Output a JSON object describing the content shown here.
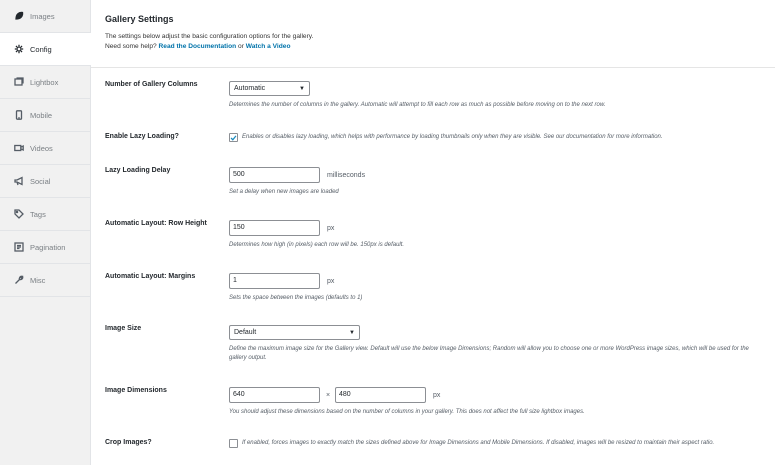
{
  "sidebar": {
    "tabs": [
      {
        "label": "Images",
        "icon": "leaf-icon",
        "active": false
      },
      {
        "label": "Config",
        "icon": "gear-icon",
        "active": true
      },
      {
        "label": "Lightbox",
        "icon": "lightbox-icon",
        "active": false
      },
      {
        "label": "Mobile",
        "icon": "mobile-icon",
        "active": false
      },
      {
        "label": "Videos",
        "icon": "video-icon",
        "active": false
      },
      {
        "label": "Social",
        "icon": "megaphone-icon",
        "active": false
      },
      {
        "label": "Tags",
        "icon": "tag-icon",
        "active": false
      },
      {
        "label": "Pagination",
        "icon": "pagination-icon",
        "active": false
      },
      {
        "label": "Misc",
        "icon": "wrench-icon",
        "active": false
      }
    ]
  },
  "header": {
    "title": "Gallery Settings",
    "desc_line1": "The settings below adjust the basic configuration options for the gallery.",
    "help_prefix": "Need some help?",
    "doc_link": "Read the Documentation",
    "or_text": "or",
    "video_link": "Watch a Video"
  },
  "settings": {
    "columns": {
      "label": "Number of Gallery Columns",
      "value": "Automatic",
      "help": "Determines the number of columns in the gallery. Automatic will attempt to fill each row as much as possible before moving on to the next row."
    },
    "lazy": {
      "label": "Enable Lazy Loading?",
      "checked": true,
      "help": "Enables or disables lazy loading, which helps with performance by loading thumbnails only when they are visible. See our documentation for more information."
    },
    "lazy_delay": {
      "label": "Lazy Loading Delay",
      "value": "500",
      "unit": "milliseconds",
      "help": "Set a delay when new images are loaded"
    },
    "row_height": {
      "label": "Automatic Layout: Row Height",
      "value": "150",
      "unit": "px",
      "help": "Determines how high (in pixels) each row will be. 150px is default."
    },
    "margins": {
      "label": "Automatic Layout: Margins",
      "value": "1",
      "unit": "px",
      "help": "Sets the space between the images (defaults to 1)"
    },
    "image_size": {
      "label": "Image Size",
      "value": "Default",
      "help": "Define the maximum image size for the Gallery view. Default will use the below Image Dimensions; Random will allow you to choose one or more WordPress image sizes, which will be used for the gallery output."
    },
    "dimensions": {
      "label": "Image Dimensions",
      "width": "640",
      "times": "×",
      "height": "480",
      "unit": "px",
      "help": "You should adjust these dimensions based on the number of columns in your gallery. This does not affect the full size lightbox images."
    },
    "crop": {
      "label": "Crop Images?",
      "checked": false,
      "help": "If enabled, forces images to exactly match the sizes defined above for Image Dimensions and Mobile Dimensions. If disabled, images will be resized to maintain their aspect ratio."
    }
  },
  "colors": {
    "link": "#0073aa",
    "sidebar_bg": "#f1f1f1",
    "text": "#23282d",
    "muted": "#555d66"
  }
}
